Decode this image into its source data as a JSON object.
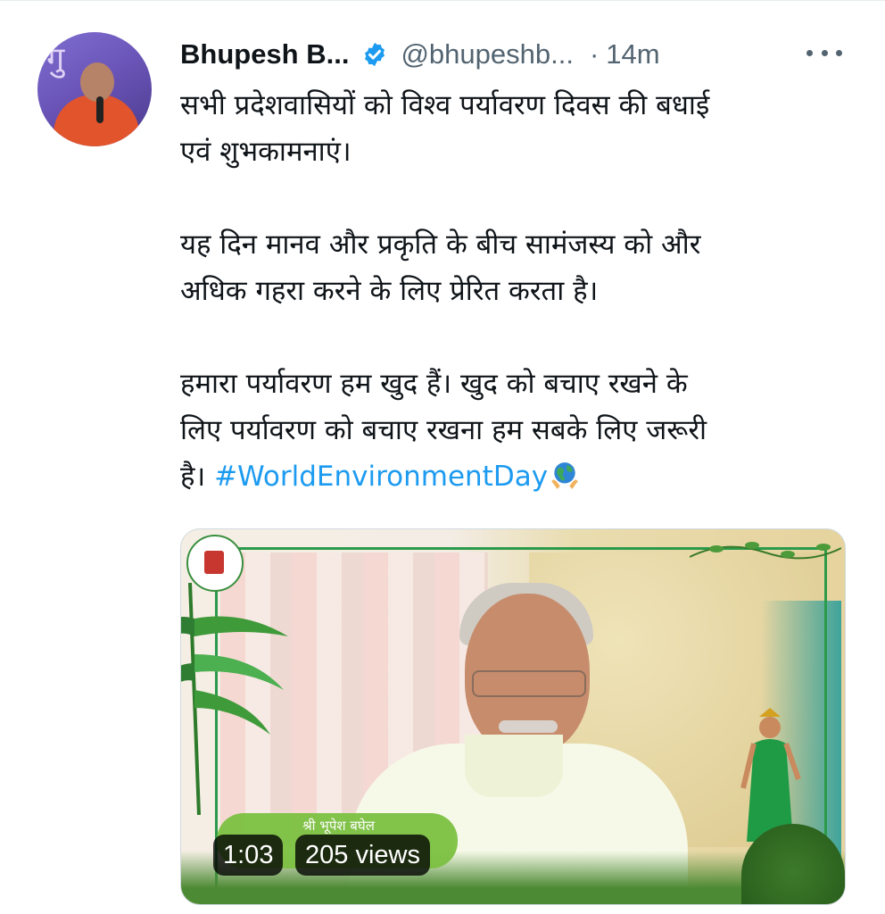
{
  "author": {
    "display_name": "Bhupesh B...",
    "handle": "@bhupeshb...",
    "separator": "·",
    "timestamp": "14m",
    "avatar_text": "गु"
  },
  "tweet": {
    "paragraph1_line1": "सभी प्रदेशवासियों को विश्व पर्यावरण दिवस की बधाई",
    "paragraph1_line2": "एवं शुभकामनाएं।",
    "paragraph2_line1": "यह दिन मानव और प्रकृति के बीच सामंजस्य को और",
    "paragraph2_line2": "अधिक गहरा करने के लिए प्रेरित करता है।",
    "paragraph3_line1": "हमारा पर्यावरण हम खुद हैं। खुद को बचाए रखने के",
    "paragraph3_line2": "लिए पर्यावरण को बचाए रखना हम सबके लिए जरूरी",
    "paragraph3_line3_prefix": "है। ",
    "hashtag": "#WorldEnvironmentDay"
  },
  "video": {
    "duration": "1:03",
    "views": "205 views",
    "nameplate_text": "श्री भूपेश बघेल"
  },
  "colors": {
    "link": "#1d9bf0",
    "verified": "#1d9bf0",
    "secondary_text": "#536471"
  },
  "icons": {
    "verified": "verified-badge-icon",
    "more": "more-options-icon",
    "hashtag_emoji": "earth-globe-hands-icon"
  }
}
